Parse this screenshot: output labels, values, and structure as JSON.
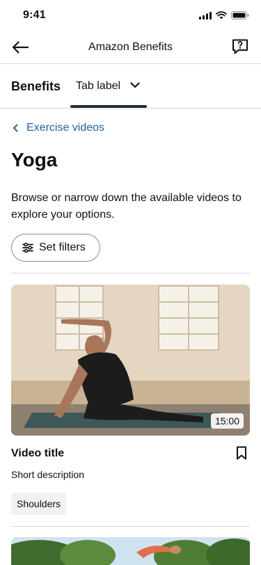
{
  "status_bar": {
    "time": "9:41",
    "icons": [
      "cellular-signal-icon",
      "wifi-icon",
      "battery-icon"
    ]
  },
  "nav": {
    "title": "Amazon Benefits",
    "back_icon": "arrow-left-icon",
    "feedback_icon": "feedback-icon"
  },
  "tabs": {
    "brand_label": "Benefits",
    "active_label": "Tab label",
    "dropdown_icon": "chevron-down-icon"
  },
  "breadcrumb": {
    "label": "Exercise videos",
    "icon": "chevron-left-icon"
  },
  "page": {
    "title": "Yoga",
    "description": "Browse or narrow down the available videos to explore your options."
  },
  "filters": {
    "label": "Set filters",
    "icon": "sliders-icon"
  },
  "videos": [
    {
      "title": "Video title",
      "description": "Short description",
      "duration": "15:00",
      "tag": "Shoulders",
      "bookmark_icon": "bookmark-icon"
    }
  ],
  "colors": {
    "link": "#2162a1",
    "text": "#0f1111",
    "divider": "#d5d9d9",
    "tab_indicator": "#232f3e",
    "chip_bg": "#f0f2f2"
  }
}
